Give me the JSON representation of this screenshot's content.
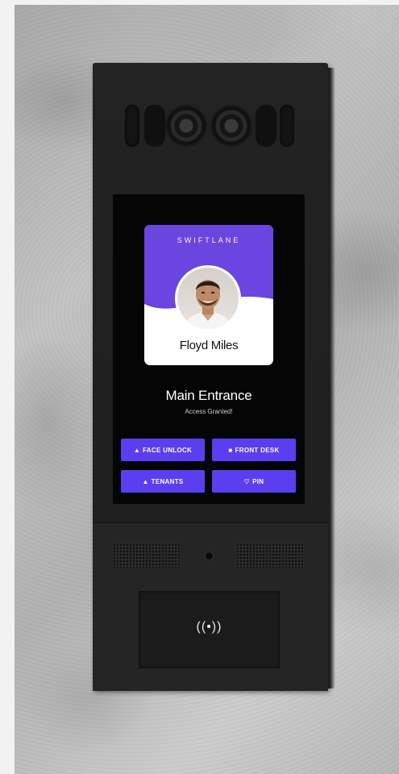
{
  "card": {
    "brand": "SWIFTLANE",
    "name": "Floyd Miles",
    "accent": "#6a45e0"
  },
  "entry": {
    "location": "Main Entrance",
    "status": "Access Granted!"
  },
  "buttons": [
    {
      "label": "FACE UNLOCK",
      "icon": "person-icon",
      "glyph": "▲"
    },
    {
      "label": "FRONT DESK",
      "icon": "video-icon",
      "glyph": "■"
    },
    {
      "label": "TENANTS",
      "icon": "people-icon",
      "glyph": "▲"
    },
    {
      "label": "PIN",
      "icon": "heart-icon",
      "glyph": "♡"
    }
  ],
  "reader": {
    "icon": "nfc-icon",
    "glyph": "((•))"
  },
  "colors": {
    "button": "#5a3ef0",
    "device": "#232323"
  }
}
